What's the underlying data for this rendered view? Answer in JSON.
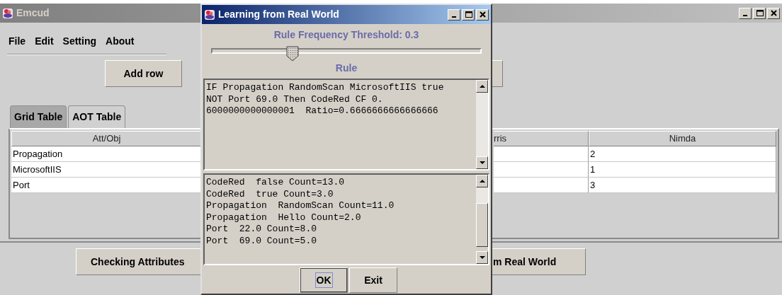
{
  "main_window": {
    "title": "Emcud",
    "menu": [
      "File",
      "Edit",
      "Setting",
      "About"
    ],
    "toolbar_buttons": [
      "Add row"
    ],
    "tabs": [
      {
        "label": "Grid Table",
        "selected": false
      },
      {
        "label": "AOT Table",
        "selected": true
      }
    ],
    "table": {
      "columns": [
        "Att/Obj",
        "rris",
        "Nimda"
      ],
      "rows": [
        {
          "att_obj": "Propagation",
          "nimda": "2"
        },
        {
          "att_obj": "MicrosoftIIS",
          "nimda": "1"
        },
        {
          "att_obj": "Port",
          "nimda": "3"
        }
      ]
    },
    "bottom_buttons": [
      "Checking Attributes",
      "m Real World"
    ]
  },
  "dialog": {
    "title": "Learning from Real World",
    "threshold_label": "Rule Frequency Threshold: 0.3",
    "threshold": {
      "level": 0.3
    },
    "rule_label": "Rule",
    "rule_lines": [
      "IF Propagation RandomScan MicrosoftIIS true",
      "NOT Port 69.0 Then CodeRed CF 0.",
      "6000000000000001  Ratio=0.6666666666666666"
    ],
    "count_lines": [
      "CodeRed  false Count=13.0",
      "CodeRed  true Count=3.0",
      "Propagation  RandomScan Count=11.0",
      "Propagation  Hello Count=2.0",
      "Port  22.0 Count=8.0",
      "Port  69.0 Count=5.0"
    ],
    "buttons": [
      {
        "label": "OK",
        "focused": true
      },
      {
        "label": "Exit",
        "focused": false
      }
    ]
  }
}
